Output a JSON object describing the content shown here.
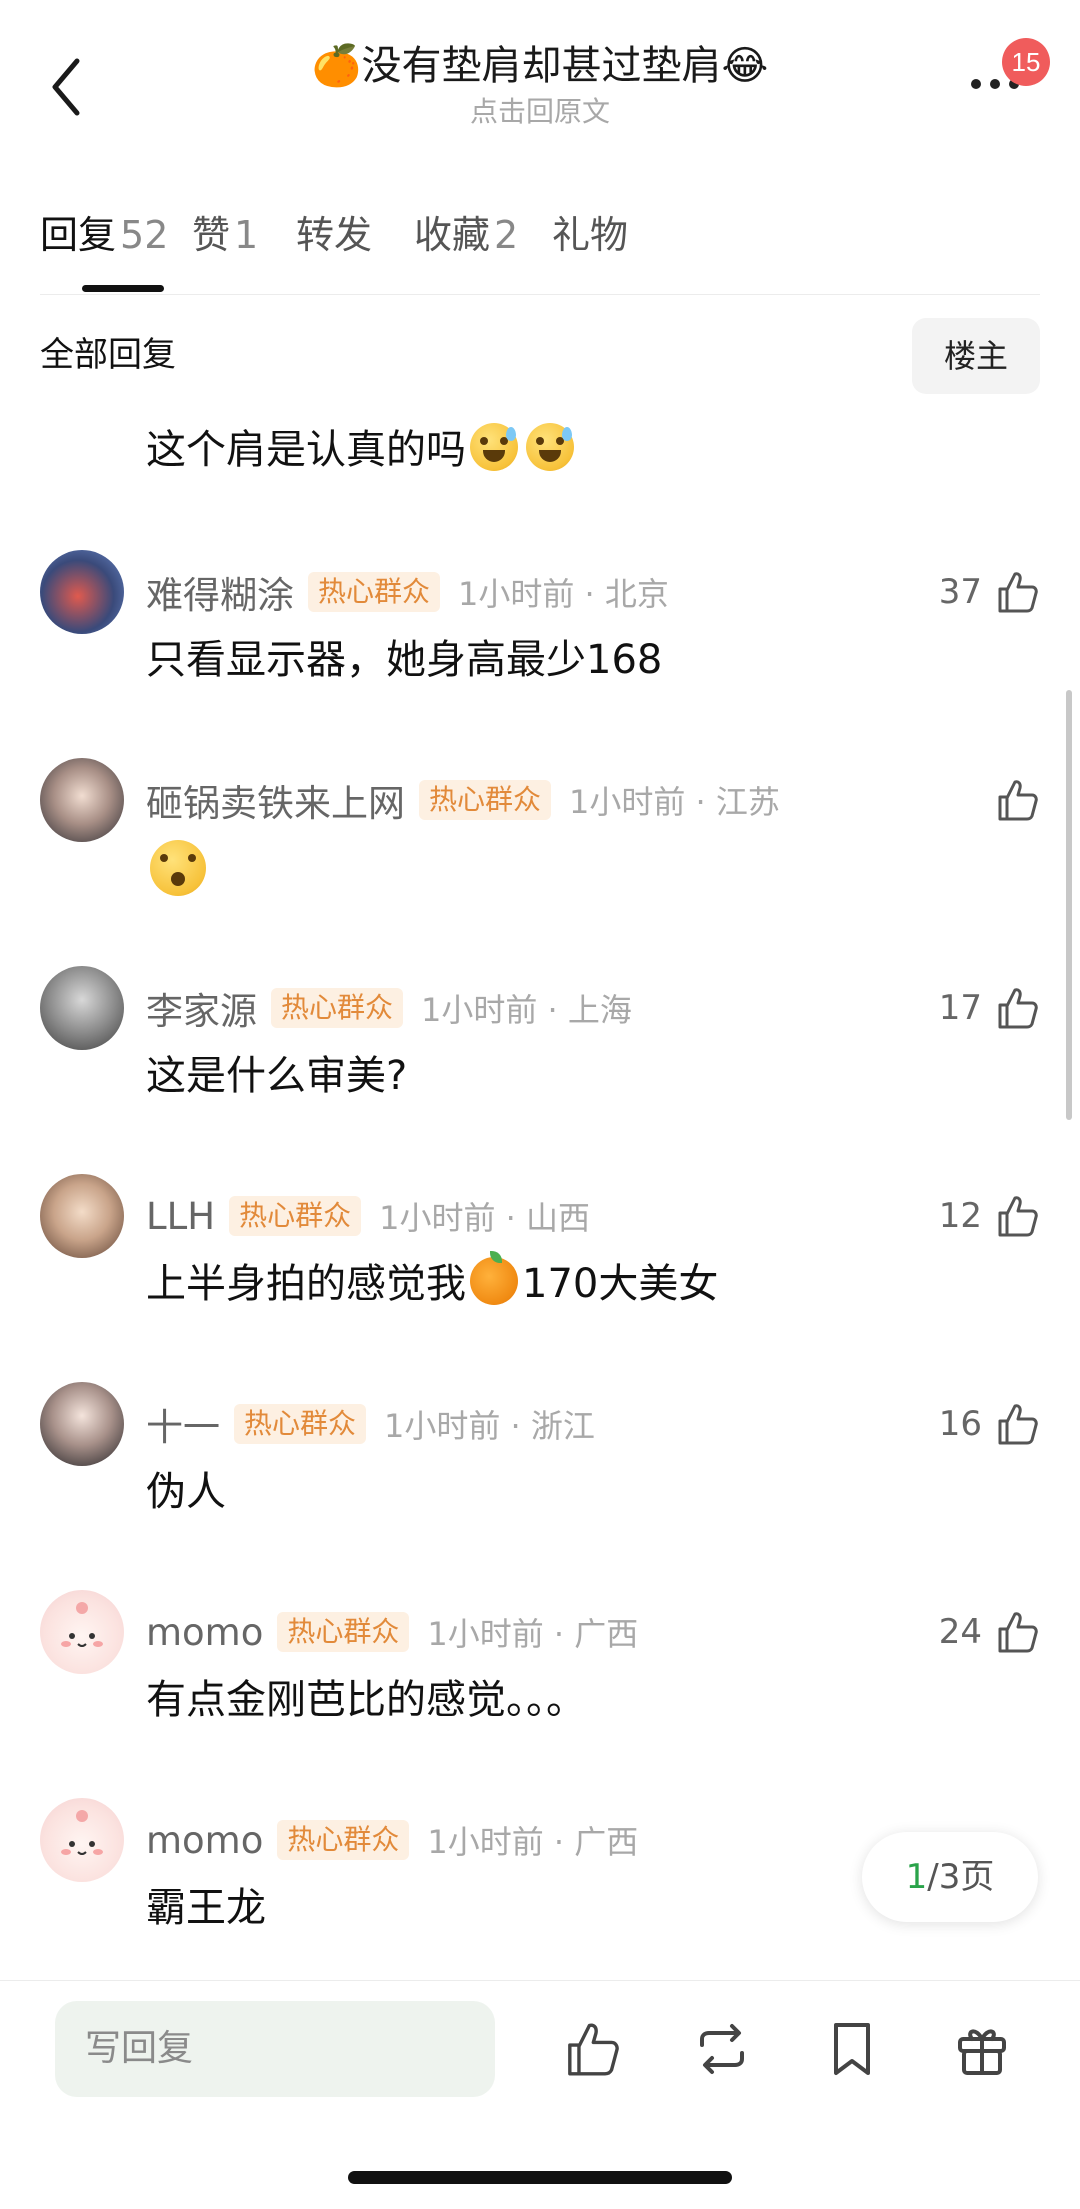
{
  "header": {
    "title": "🍊没有垫肩却甚过垫肩😂",
    "subtitle": "点击回原文",
    "notification_count": "15"
  },
  "tabs": [
    {
      "label": "回复",
      "count": "52"
    },
    {
      "label": "赞",
      "count": "1"
    },
    {
      "label": "转发",
      "count": ""
    },
    {
      "label": "收藏",
      "count": "2"
    },
    {
      "label": "礼物",
      "count": ""
    }
  ],
  "filter": {
    "label": "全部回复",
    "owner_button": "楼主"
  },
  "comments": [
    {
      "name": "",
      "tag": "",
      "meta": "",
      "text": "这个肩是认真的吗",
      "likes": ""
    },
    {
      "name": "难得糊涂",
      "tag": "热心群众",
      "meta": "1小时前 · 北京",
      "text": "只看显示器，她身高最少168",
      "likes": "37"
    },
    {
      "name": "砸锅卖铁来上网",
      "tag": "热心群众",
      "meta": "1小时前 · 江苏",
      "text": "",
      "likes": ""
    },
    {
      "name": "李家源",
      "tag": "热心群众",
      "meta": "1小时前 · 上海",
      "text": "这是什么审美?",
      "likes": "17"
    },
    {
      "name": "LLH",
      "tag": "热心群众",
      "meta": "1小时前 · 山西",
      "text_before": "上半身拍的感觉我",
      "text_after": "170大美女",
      "likes": "12"
    },
    {
      "name": "十一",
      "tag": "热心群众",
      "meta": "1小时前 · 浙江",
      "text": "伪人",
      "likes": "16"
    },
    {
      "name": "momo",
      "tag": "热心群众",
      "meta": "1小时前 · 广西",
      "text": "有点金刚芭比的感觉。。。",
      "likes": "24"
    },
    {
      "name": "momo",
      "tag": "热心群众",
      "meta": "1小时前 · 广西",
      "text": "霸王龙",
      "likes": ""
    }
  ],
  "pagination": {
    "current": "1",
    "total_text": "/3页"
  },
  "bottom_bar": {
    "reply_placeholder": "写回复"
  },
  "colors": {
    "tag_bg": "#fdf0e2",
    "tag_text": "#e28a3a",
    "badge": "#f05c5c",
    "page_current": "#2aa34a",
    "input_bg": "#eef3ee"
  }
}
